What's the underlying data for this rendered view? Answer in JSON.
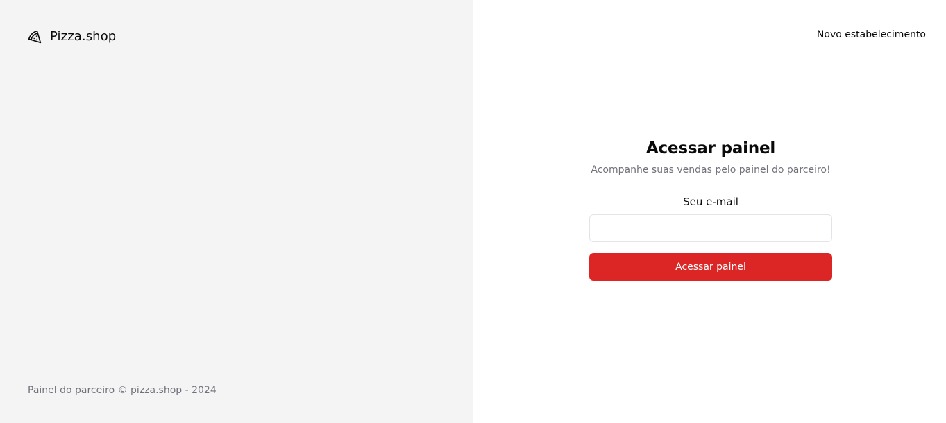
{
  "brand": {
    "icon": "pizza-icon",
    "name": "Pizza.shop"
  },
  "left_footer": {
    "text": "Painel do parceiro © pizza.shop - 2024"
  },
  "header": {
    "new_establishment_link": "Novo estabelecimento"
  },
  "login": {
    "title": "Acessar painel",
    "subtitle": "Acompanhe suas vendas pelo painel do parceiro!",
    "email_label": "Seu e-mail",
    "email_value": "",
    "email_placeholder": "",
    "submit_label": "Acessar painel"
  },
  "colors": {
    "accent": "#dc2626",
    "left_panel_bg": "#f4f4f5",
    "muted_text": "#71717a"
  }
}
